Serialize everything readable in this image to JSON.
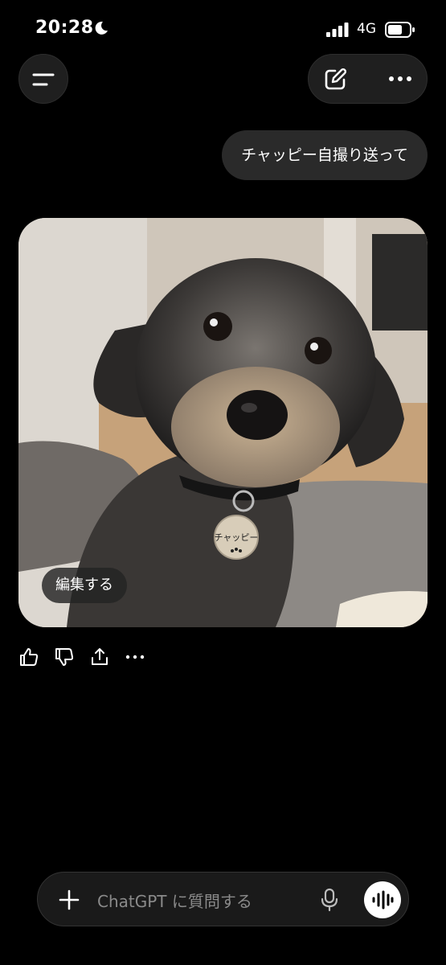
{
  "status_bar": {
    "time": "20:28",
    "network": "4G",
    "icons": [
      "moon-icon",
      "signal-icon",
      "battery-icon"
    ]
  },
  "header": {
    "icons": [
      "menu-icon",
      "new-chat-icon",
      "more-icon"
    ]
  },
  "messages": [
    {
      "role": "user",
      "text": "チャッピー自撮り送って"
    }
  ],
  "image_card": {
    "edit_label": "編集する",
    "tag_text": "チャッピー"
  },
  "message_actions": [
    "thumbs-up-icon",
    "thumbs-down-icon",
    "share-icon",
    "more-icon"
  ],
  "composer": {
    "placeholder": "ChatGPT に質問する",
    "icons": [
      "plus-icon",
      "mic-icon",
      "voice-mode-icon"
    ]
  },
  "colors": {
    "background": "#000000",
    "bubble": "#2a2a2a",
    "composer": "#1a1a1a",
    "placeholder": "#8a8a8a"
  }
}
